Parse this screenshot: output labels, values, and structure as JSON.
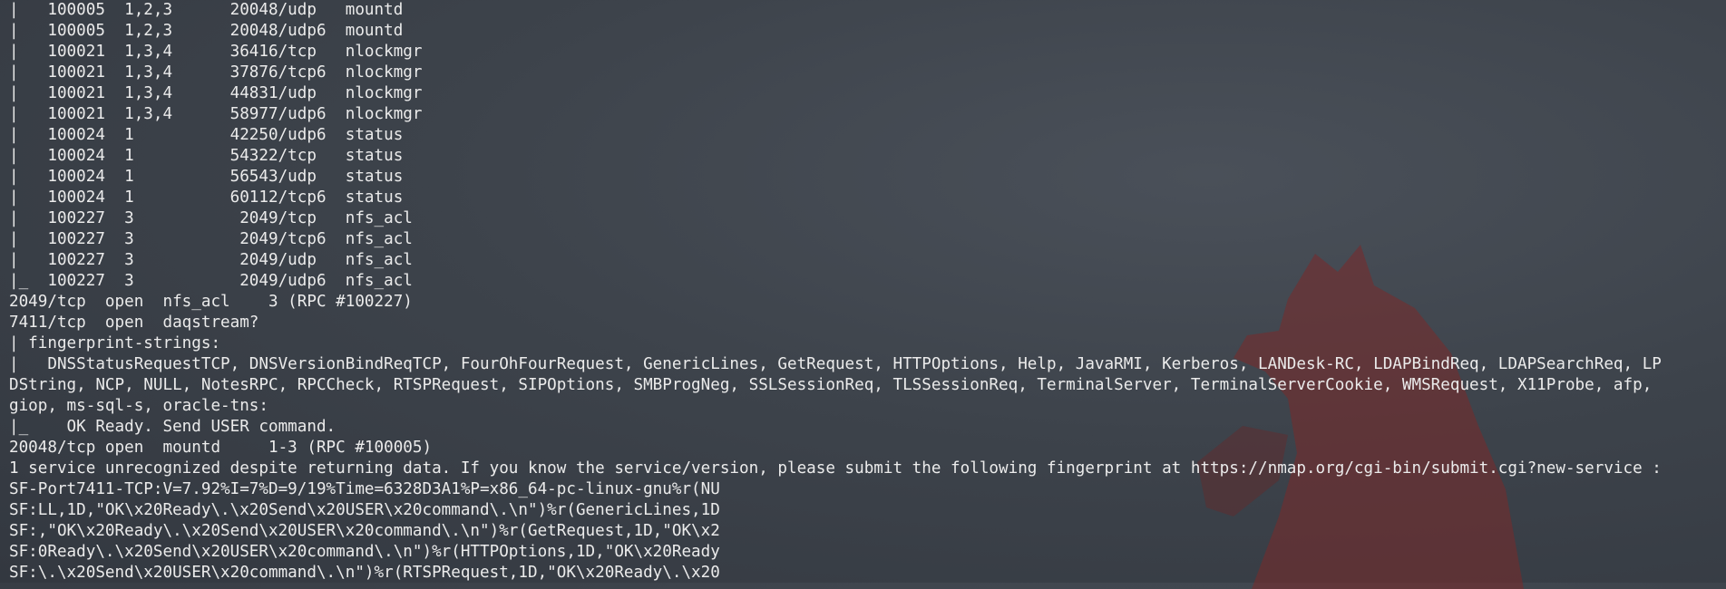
{
  "terminal": {
    "lines": [
      "|   100005  1,2,3      20048/udp   mountd",
      "|   100005  1,2,3      20048/udp6  mountd",
      "|   100021  1,3,4      36416/tcp   nlockmgr",
      "|   100021  1,3,4      37876/tcp6  nlockmgr",
      "|   100021  1,3,4      44831/udp   nlockmgr",
      "|   100021  1,3,4      58977/udp6  nlockmgr",
      "|   100024  1          42250/udp6  status",
      "|   100024  1          54322/tcp   status",
      "|   100024  1          56543/udp   status",
      "|   100024  1          60112/tcp6  status",
      "|   100227  3           2049/tcp   nfs_acl",
      "|   100227  3           2049/tcp6  nfs_acl",
      "|   100227  3           2049/udp   nfs_acl",
      "|_  100227  3           2049/udp6  nfs_acl",
      "2049/tcp  open  nfs_acl    3 (RPC #100227)",
      "7411/tcp  open  daqstream?",
      "| fingerprint-strings:",
      "|   DNSStatusRequestTCP, DNSVersionBindReqTCP, FourOhFourRequest, GenericLines, GetRequest, HTTPOptions, Help, JavaRMI, Kerberos, LANDesk-RC, LDAPBindReq, LDAPSearchReq, LP",
      "DString, NCP, NULL, NotesRPC, RPCCheck, RTSPRequest, SIPOptions, SMBProgNeg, SSLSessionReq, TLSSessionReq, TerminalServer, TerminalServerCookie, WMSRequest, X11Probe, afp,",
      "giop, ms-sql-s, oracle-tns:",
      "|_    OK Ready. Send USER command.",
      "20048/tcp open  mountd     1-3 (RPC #100005)",
      "1 service unrecognized despite returning data. If you know the service/version, please submit the following fingerprint at https://nmap.org/cgi-bin/submit.cgi?new-service :",
      "SF-Port7411-TCP:V=7.92%I=7%D=9/19%Time=6328D3A1%P=x86_64-pc-linux-gnu%r(NU",
      "SF:LL,1D,\"OK\\x20Ready\\.\\x20Send\\x20USER\\x20command\\.\\n\")%r(GenericLines,1D",
      "SF:,\"OK\\x20Ready\\.\\x20Send\\x20USER\\x20command\\.\\n\")%r(GetRequest,1D,\"OK\\x2",
      "SF:0Ready\\.\\x20Send\\x20USER\\x20command\\.\\n\")%r(HTTPOptions,1D,\"OK\\x20Ready",
      "SF:\\.\\x20Send\\x20USER\\x20command\\.\\n\")%r(RTSPRequest,1D,\"OK\\x20Ready\\.\\x20"
    ]
  },
  "wallpaper": {
    "icon": "fox-silhouette-icon",
    "color": "#7a2a2a"
  }
}
